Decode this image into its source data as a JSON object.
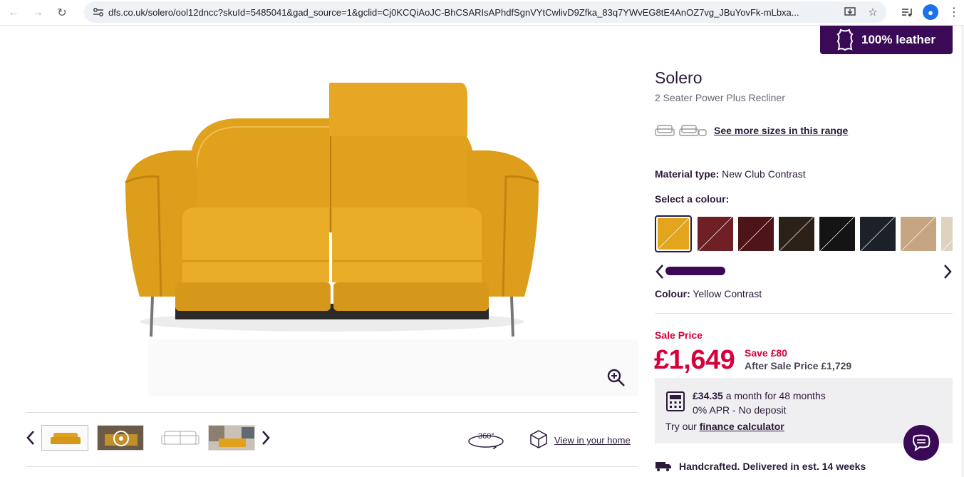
{
  "browser": {
    "url": "dfs.co.uk/solero/ool12dncc?skuId=5485041&gad_source=1&gclid=Cj0KCQiAoJC-BhCSARIsAPhdfSgnVYtCwlivD9Zfka_83q7YWvEG8tE4AnOZ7vg_JBuYovFk-mLbxa..."
  },
  "badge": {
    "label": "100% leather"
  },
  "product": {
    "name": "Solero",
    "subtitle": "2 Seater Power Plus Recliner",
    "sizes_link": "See more sizes in this range",
    "material_label": "Material type:",
    "material_value": "New Club Contrast",
    "select_colour": "Select a colour:",
    "colour_label": "Colour:",
    "colour_value": "Yellow Contrast",
    "swatch_colors": [
      "#e3a51c",
      "#6e2024",
      "#4d1518",
      "#2b2118",
      "#141414",
      "#1c2029",
      "#c6a682",
      "#ddd3bf"
    ]
  },
  "pricing": {
    "sale_label": "Sale Price",
    "price": "£1,649",
    "save": "Save £80",
    "after_sale": "After Sale Price £1,729"
  },
  "finance": {
    "monthly": "£34.35",
    "monthly_rest": " a month for 48 months",
    "apr": "0% APR - No deposit",
    "try_prefix": "Try our ",
    "calculator_link": "finance calculator"
  },
  "gallery": {
    "view_360": "360°",
    "view_home": "View in your home"
  },
  "delivery": {
    "text": "Handcrafted. Delivered in est. 14 weeks"
  },
  "colors": {
    "brand": "#3a0a57",
    "sale": "#d6003a"
  }
}
